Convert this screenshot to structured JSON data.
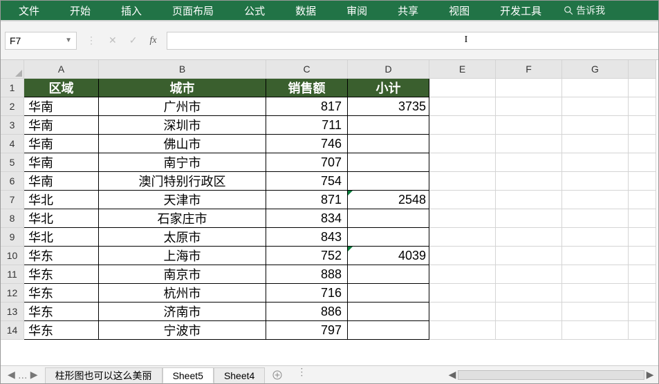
{
  "ribbon": {
    "tabs": [
      "文件",
      "开始",
      "插入",
      "页面布局",
      "公式",
      "数据",
      "审阅",
      "共享",
      "视图",
      "开发工具"
    ],
    "tellme": "告诉我"
  },
  "namebox": {
    "value": "F7"
  },
  "formula": {
    "value": ""
  },
  "columns": [
    "A",
    "B",
    "C",
    "D",
    "E",
    "F",
    "G",
    ""
  ],
  "rows_count": 14,
  "header_row": {
    "A": "区域",
    "B": "城市",
    "C": "销售额",
    "D": "小计"
  },
  "data": [
    {
      "A": "华南",
      "B": "广州市",
      "C": "817",
      "D": "3735"
    },
    {
      "A": "华南",
      "B": "深圳市",
      "C": "711",
      "D": ""
    },
    {
      "A": "华南",
      "B": "佛山市",
      "C": "746",
      "D": ""
    },
    {
      "A": "华南",
      "B": "南宁市",
      "C": "707",
      "D": ""
    },
    {
      "A": "华南",
      "B": "澳门特别行政区",
      "C": "754",
      "D": ""
    },
    {
      "A": "华北",
      "B": "天津市",
      "C": "871",
      "D": "2548"
    },
    {
      "A": "华北",
      "B": "石家庄市",
      "C": "834",
      "D": ""
    },
    {
      "A": "华北",
      "B": "太原市",
      "C": "843",
      "D": ""
    },
    {
      "A": "华东",
      "B": "上海市",
      "C": "752",
      "D": "4039"
    },
    {
      "A": "华东",
      "B": "南京市",
      "C": "888",
      "D": ""
    },
    {
      "A": "华东",
      "B": "杭州市",
      "C": "716",
      "D": ""
    },
    {
      "A": "华东",
      "B": "济南市",
      "C": "886",
      "D": ""
    },
    {
      "A": "华东",
      "B": "宁波市",
      "C": "797",
      "D": ""
    }
  ],
  "sheet_tabs": {
    "items": [
      "柱形图也可以这么美丽",
      "Sheet5",
      "Sheet4"
    ],
    "active_index": 1
  },
  "chart_data": {
    "type": "table",
    "title": "",
    "columns": [
      "区域",
      "城市",
      "销售额",
      "小计"
    ],
    "rows": [
      [
        "华南",
        "广州市",
        817,
        3735
      ],
      [
        "华南",
        "深圳市",
        711,
        null
      ],
      [
        "华南",
        "佛山市",
        746,
        null
      ],
      [
        "华南",
        "南宁市",
        707,
        null
      ],
      [
        "华南",
        "澳门特别行政区",
        754,
        null
      ],
      [
        "华北",
        "天津市",
        871,
        2548
      ],
      [
        "华北",
        "石家庄市",
        834,
        null
      ],
      [
        "华北",
        "太原市",
        843,
        null
      ],
      [
        "华东",
        "上海市",
        752,
        4039
      ],
      [
        "华东",
        "南京市",
        888,
        null
      ],
      [
        "华东",
        "杭州市",
        716,
        null
      ],
      [
        "华东",
        "济南市",
        886,
        null
      ],
      [
        "华东",
        "宁波市",
        797,
        null
      ]
    ]
  }
}
